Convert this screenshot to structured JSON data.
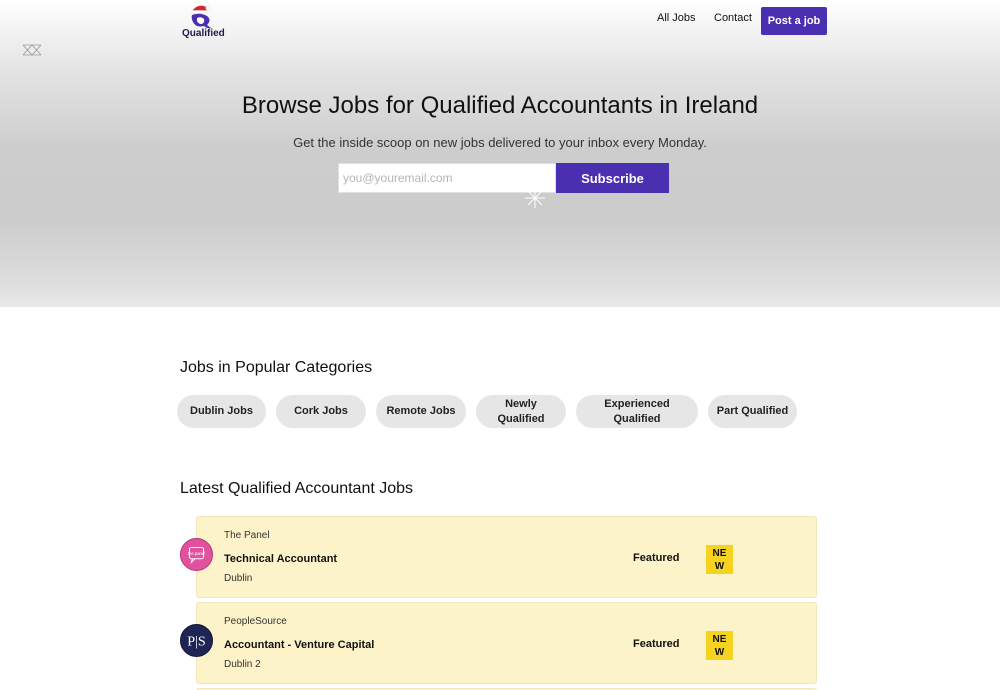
{
  "header": {
    "logo_text": "Qualified",
    "nav": {
      "all_jobs": "All Jobs",
      "contact": "Contact",
      "post_job": "Post a job"
    }
  },
  "hero": {
    "title": "Browse Jobs for Qualified Accountants in Ireland",
    "subtitle": "Get the inside scoop on new jobs delivered to your inbox every Monday.",
    "email_placeholder": "you@youremail.com",
    "subscribe_label": "Subscribe"
  },
  "categories": {
    "title": "Jobs in Popular Categories",
    "items": [
      {
        "label": "Dublin Jobs"
      },
      {
        "label": "Cork Jobs"
      },
      {
        "label": "Remote Jobs"
      },
      {
        "label": "Newly Qualified"
      },
      {
        "label": "Experienced Qualified"
      },
      {
        "label": "Part Qualified"
      }
    ]
  },
  "latest": {
    "title": "Latest Qualified Accountant Jobs",
    "jobs": [
      {
        "company": "The Panel",
        "title": "Technical Accountant",
        "location": "Dublin",
        "tag": "Featured",
        "badge": "NEW",
        "logo_text": "the panel"
      },
      {
        "company": "PeopleSource",
        "title": "Accountant - Venture Capital",
        "location": "Dublin 2",
        "tag": "Featured",
        "badge": "NEW",
        "logo_text": "P|S"
      }
    ]
  },
  "colors": {
    "accent": "#4a2fb0",
    "featured_bg": "#fdf3c9",
    "badge": "#f6d321",
    "chip": "#e6e6e6"
  }
}
